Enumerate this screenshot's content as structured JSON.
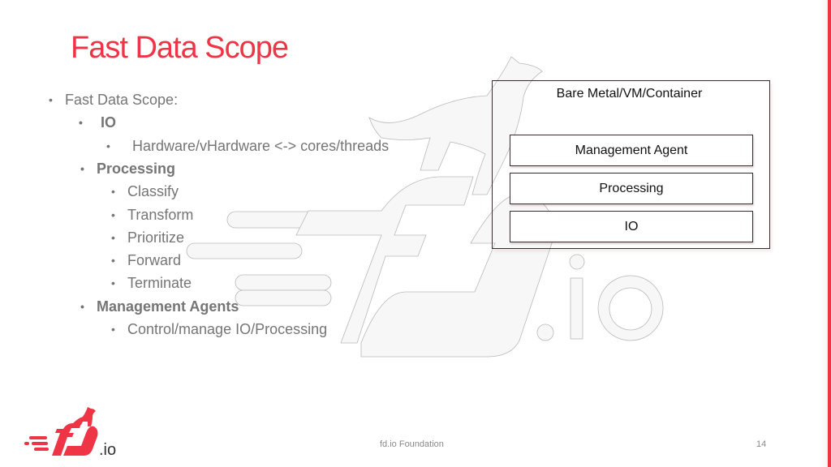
{
  "slide": {
    "title": "Fast Data Scope",
    "accent_color": "#ee3445",
    "bullets": [
      {
        "level": 1,
        "text": "Fast Data Scope:",
        "bold": false
      },
      {
        "level": 2,
        "text": "IO",
        "bold": true
      },
      {
        "level": 3,
        "text": "Hardware/vHardware <-> cores/threads",
        "bold": false
      },
      {
        "level": 2,
        "text": "Processing",
        "bold": true
      },
      {
        "level": 3,
        "text": "Classify",
        "bold": false
      },
      {
        "level": 3,
        "text": "Transform",
        "bold": false
      },
      {
        "level": 3,
        "text": "Prioritize",
        "bold": false
      },
      {
        "level": 3,
        "text": "Forward",
        "bold": false
      },
      {
        "level": 3,
        "text": "Terminate",
        "bold": false
      },
      {
        "level": 2,
        "text": "Management Agents",
        "bold": true
      },
      {
        "level": 3,
        "text": "Control/manage IO/Processing",
        "bold": false
      }
    ],
    "bullet_glyph": "•"
  },
  "diagram": {
    "container_label": "Bare Metal/VM/Container",
    "layers": [
      "Management Agent",
      "Processing",
      "IO"
    ]
  },
  "footer": {
    "text": "fd.io Foundation",
    "page_number": "14"
  },
  "logo": {
    "text": ".io",
    "icon": "fdio-dog-logo"
  },
  "watermark": {
    "text": ".io",
    "icon": "fdio-dog-logo-outline"
  }
}
